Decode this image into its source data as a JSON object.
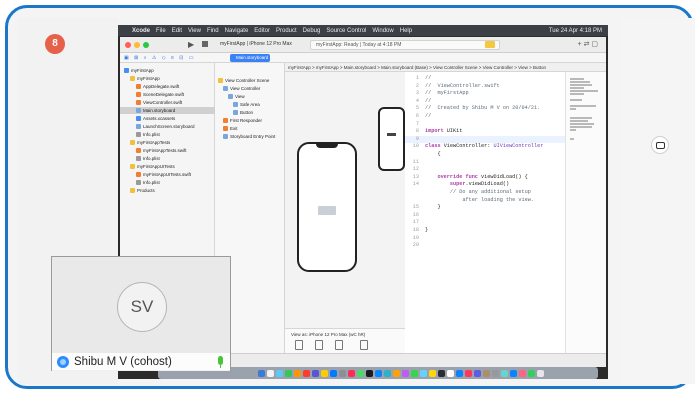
{
  "meeting": {
    "participant_initials": "SV",
    "participant_name": "Shibu M V (cohost)",
    "badge": "8"
  },
  "menubar": {
    "app": "Xcode",
    "items": [
      "File",
      "Edit",
      "View",
      "Find",
      "Navigate",
      "Editor",
      "Product",
      "Debug",
      "Source Control",
      "Window",
      "Help"
    ],
    "clock": "Tue 24 Apr 4:18 PM"
  },
  "toolbar": {
    "scheme": "myFirstApp | iPhone 12 Pro Max",
    "status": "myFirstApp: Ready | Today at 4:18 PM"
  },
  "tab": {
    "active_label": "Main.storyboard"
  },
  "jumpbar": {
    "path": "myFirstApp > myFirstApp > Main.storyboard > Main.storyboard (Base) > View Controller Scene > View Controller > View > Button"
  },
  "navigator": {
    "items": [
      {
        "label": "myFirstApp",
        "indent": 0,
        "color": "#4a8df0",
        "selected": false
      },
      {
        "label": "myFirstApp",
        "indent": 1,
        "color": "#f0c040",
        "selected": false
      },
      {
        "label": "AppDelegate.swift",
        "indent": 2,
        "color": "#f08030",
        "selected": false
      },
      {
        "label": "SceneDelegate.swift",
        "indent": 2,
        "color": "#f08030",
        "selected": false
      },
      {
        "label": "ViewController.swift",
        "indent": 2,
        "color": "#f08030",
        "selected": false
      },
      {
        "label": "Main.storyboard",
        "indent": 2,
        "color": "#7aa6e0",
        "selected": true
      },
      {
        "label": "Assets.xcassets",
        "indent": 2,
        "color": "#4a8df0",
        "selected": false
      },
      {
        "label": "LaunchScreen.storyboard",
        "indent": 2,
        "color": "#7aa6e0",
        "selected": false
      },
      {
        "label": "Info.plist",
        "indent": 2,
        "color": "#999999",
        "selected": false
      },
      {
        "label": "myFirstAppTests",
        "indent": 1,
        "color": "#f0c040",
        "selected": false
      },
      {
        "label": "myFirstAppTests.swift",
        "indent": 2,
        "color": "#f08030",
        "selected": false
      },
      {
        "label": "Info.plist",
        "indent": 2,
        "color": "#999999",
        "selected": false
      },
      {
        "label": "myFirstAppUITests",
        "indent": 1,
        "color": "#f0c040",
        "selected": false
      },
      {
        "label": "myFirstAppUITests.swift",
        "indent": 2,
        "color": "#f08030",
        "selected": false
      },
      {
        "label": "Info.plist",
        "indent": 2,
        "color": "#999999",
        "selected": false
      },
      {
        "label": "Products",
        "indent": 1,
        "color": "#f0c040",
        "selected": false
      }
    ]
  },
  "outline": {
    "items": [
      {
        "label": "View Controller Scene",
        "indent": 0
      },
      {
        "label": "View Controller",
        "indent": 1
      },
      {
        "label": "View",
        "indent": 2
      },
      {
        "label": "Safe Area",
        "indent": 3
      },
      {
        "label": "Button",
        "indent": 3
      },
      {
        "label": "First Responder",
        "indent": 1
      },
      {
        "label": "Exit",
        "indent": 1
      },
      {
        "label": "Storyboard Entry Point",
        "indent": 1
      }
    ]
  },
  "device": {
    "label": "View as: iPhone 12 Pro Max (wC hR)"
  },
  "code": {
    "lines": [
      {
        "n": "1",
        "segs": [
          {
            "c": "cmt",
            "t": "//"
          }
        ]
      },
      {
        "n": "2",
        "segs": [
          {
            "c": "cmt",
            "t": "//  ViewController.swift"
          }
        ]
      },
      {
        "n": "3",
        "segs": [
          {
            "c": "cmt",
            "t": "//  myFirstApp"
          }
        ]
      },
      {
        "n": "4",
        "segs": [
          {
            "c": "cmt",
            "t": "//"
          }
        ]
      },
      {
        "n": "5",
        "segs": [
          {
            "c": "cmt",
            "t": "//  Created by Shibu M V on 20/04/21."
          }
        ]
      },
      {
        "n": "6",
        "segs": [
          {
            "c": "cmt",
            "t": "//"
          }
        ]
      },
      {
        "n": "7",
        "segs": []
      },
      {
        "n": "8",
        "segs": [
          {
            "c": "kw",
            "t": "import"
          },
          {
            "c": "plain",
            "t": " UIKit"
          }
        ]
      },
      {
        "n": "9",
        "segs": [],
        "cursor": true
      },
      {
        "n": "10",
        "segs": [
          {
            "c": "kw",
            "t": "class"
          },
          {
            "c": "plain",
            "t": " ViewController: "
          },
          {
            "c": "ty",
            "t": "UIViewController"
          }
        ]
      },
      {
        "n": "",
        "segs": [
          {
            "c": "plain",
            "t": "    {"
          }
        ]
      },
      {
        "n": "11",
        "segs": []
      },
      {
        "n": "12",
        "segs": []
      },
      {
        "n": "13",
        "segs": [
          {
            "c": "kw",
            "t": "    override func"
          },
          {
            "c": "plain",
            "t": " viewDidLoad() {"
          }
        ]
      },
      {
        "n": "14",
        "segs": [
          {
            "c": "kw",
            "t": "        super"
          },
          {
            "c": "plain",
            "t": ".viewDidLoad()"
          }
        ]
      },
      {
        "n": "",
        "segs": [
          {
            "c": "cmt",
            "t": "        // Do any additional setup"
          }
        ]
      },
      {
        "n": "",
        "segs": [
          {
            "c": "cmt",
            "t": "            after loading the view."
          }
        ]
      },
      {
        "n": "15",
        "segs": [
          {
            "c": "plain",
            "t": "    }"
          }
        ]
      },
      {
        "n": "16",
        "segs": []
      },
      {
        "n": "17",
        "segs": []
      },
      {
        "n": "18",
        "segs": [
          {
            "c": "plain",
            "t": "}"
          }
        ]
      },
      {
        "n": "19",
        "segs": []
      },
      {
        "n": "20",
        "segs": []
      }
    ]
  },
  "dock": {
    "icon_colors": [
      "#3a7bd5",
      "#f2f2f2",
      "#5ac8fa",
      "#34c759",
      "#ff9500",
      "#ff3b30",
      "#5856d6",
      "#ffcc00",
      "#007aff",
      "#8e8e93",
      "#ff2d55",
      "#4cd964",
      "#1c1c1e",
      "#0a84ff",
      "#30b0c7",
      "#ff9f0a",
      "#bf5af2",
      "#32d74b",
      "#64d2ff",
      "#ffd60a",
      "#2c2c2e",
      "#ffffff",
      "#0a84ff",
      "#ff375f",
      "#5e5ce6",
      "#ac8e68",
      "#98989d",
      "#66d4cf",
      "#0a84ff",
      "#ff6482",
      "#30d158",
      "#e5e5ea"
    ]
  },
  "icons": {
    "side_button": "screen-share-icon",
    "zoom_logo": "zoom-logo-icon",
    "mic": "microphone-icon"
  }
}
